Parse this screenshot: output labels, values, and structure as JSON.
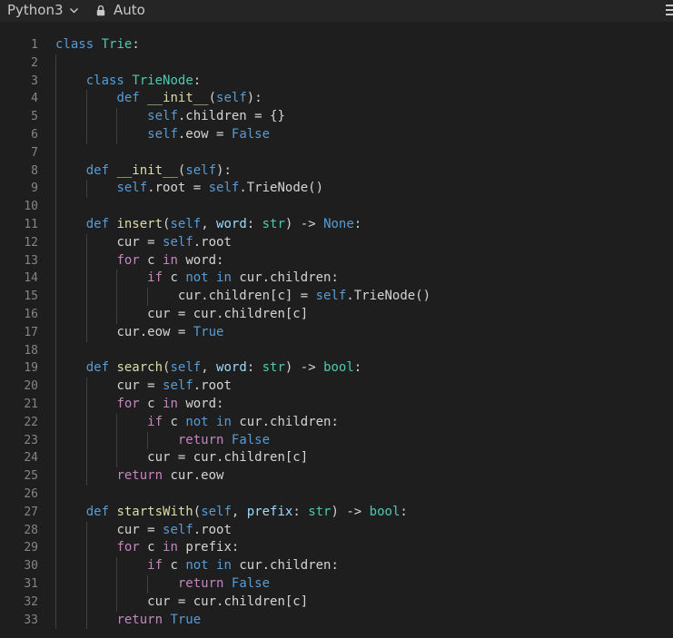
{
  "toolbar": {
    "language": "Python3",
    "language_icon": "chevron-down-icon",
    "mode": "Auto",
    "mode_icon": "lock-icon",
    "menu_icon": "hamburger-menu-icon"
  },
  "theme": {
    "background": "#1e1e1e",
    "keyword": "#569cd6",
    "control": "#c586c0",
    "class_name": "#4ec9b0",
    "function_name": "#dcdcaa",
    "parameter": "#9cdcfe",
    "text": "#d4d4d4",
    "line_number": "#858585"
  },
  "editor": {
    "lines": [
      {
        "n": "1",
        "indent": 0,
        "tokens": [
          [
            "class",
            "kw"
          ],
          [
            " ",
            ""
          ],
          [
            "Trie",
            "cls"
          ],
          [
            ":",
            ""
          ]
        ]
      },
      {
        "n": "2",
        "indent": 1,
        "tokens": []
      },
      {
        "n": "3",
        "indent": 1,
        "tokens": [
          [
            "class",
            "kw"
          ],
          [
            " ",
            ""
          ],
          [
            "TrieNode",
            "cls"
          ],
          [
            ":",
            ""
          ]
        ]
      },
      {
        "n": "4",
        "indent": 2,
        "tokens": [
          [
            "def",
            "kw"
          ],
          [
            " ",
            ""
          ],
          [
            "__init__",
            "fn"
          ],
          [
            "(",
            ""
          ],
          [
            "self",
            "slf"
          ],
          [
            "):",
            ""
          ]
        ]
      },
      {
        "n": "5",
        "indent": 3,
        "tokens": [
          [
            "self",
            "slf"
          ],
          [
            ".children = {}",
            ""
          ]
        ]
      },
      {
        "n": "6",
        "indent": 3,
        "tokens": [
          [
            "self",
            "slf"
          ],
          [
            ".eow = ",
            ""
          ],
          [
            "False",
            "kw"
          ]
        ]
      },
      {
        "n": "7",
        "indent": 1,
        "tokens": []
      },
      {
        "n": "8",
        "indent": 1,
        "tokens": [
          [
            "def",
            "kw"
          ],
          [
            " ",
            ""
          ],
          [
            "__init__",
            "fn"
          ],
          [
            "(",
            ""
          ],
          [
            "self",
            "slf"
          ],
          [
            "):",
            ""
          ]
        ]
      },
      {
        "n": "9",
        "indent": 2,
        "tokens": [
          [
            "self",
            "slf"
          ],
          [
            ".root = ",
            ""
          ],
          [
            "self",
            "slf"
          ],
          [
            ".TrieNode()",
            ""
          ]
        ]
      },
      {
        "n": "10",
        "indent": 1,
        "tokens": []
      },
      {
        "n": "11",
        "indent": 1,
        "tokens": [
          [
            "def",
            "kw"
          ],
          [
            " ",
            ""
          ],
          [
            "insert",
            "fn"
          ],
          [
            "(",
            ""
          ],
          [
            "self",
            "slf"
          ],
          [
            ", ",
            ""
          ],
          [
            "word",
            "prm"
          ],
          [
            ": ",
            ""
          ],
          [
            "str",
            "cls"
          ],
          [
            ") -> ",
            ""
          ],
          [
            "None",
            "kw"
          ],
          [
            ":",
            ""
          ]
        ]
      },
      {
        "n": "12",
        "indent": 2,
        "tokens": [
          [
            "cur = ",
            ""
          ],
          [
            "self",
            "slf"
          ],
          [
            ".root",
            ""
          ]
        ]
      },
      {
        "n": "13",
        "indent": 2,
        "tokens": [
          [
            "for",
            "ctl"
          ],
          [
            " c ",
            ""
          ],
          [
            "in",
            "ctl"
          ],
          [
            " word:",
            ""
          ]
        ]
      },
      {
        "n": "14",
        "indent": 3,
        "tokens": [
          [
            "if",
            "ctl"
          ],
          [
            " c ",
            ""
          ],
          [
            "not",
            "kw"
          ],
          [
            " ",
            ""
          ],
          [
            "in",
            "kw"
          ],
          [
            " cur.children:",
            ""
          ]
        ]
      },
      {
        "n": "15",
        "indent": 4,
        "tokens": [
          [
            "cur.children[c] = ",
            ""
          ],
          [
            "self",
            "slf"
          ],
          [
            ".TrieNode()",
            ""
          ]
        ]
      },
      {
        "n": "16",
        "indent": 3,
        "tokens": [
          [
            "cur = cur.children[c]",
            ""
          ]
        ]
      },
      {
        "n": "17",
        "indent": 2,
        "tokens": [
          [
            "cur.eow = ",
            ""
          ],
          [
            "True",
            "kw"
          ]
        ]
      },
      {
        "n": "18",
        "indent": 1,
        "tokens": []
      },
      {
        "n": "19",
        "indent": 1,
        "tokens": [
          [
            "def",
            "kw"
          ],
          [
            " ",
            ""
          ],
          [
            "search",
            "fn"
          ],
          [
            "(",
            ""
          ],
          [
            "self",
            "slf"
          ],
          [
            ", ",
            ""
          ],
          [
            "word",
            "prm"
          ],
          [
            ": ",
            ""
          ],
          [
            "str",
            "cls"
          ],
          [
            ") -> ",
            ""
          ],
          [
            "bool",
            "cls"
          ],
          [
            ":",
            ""
          ]
        ]
      },
      {
        "n": "20",
        "indent": 2,
        "tokens": [
          [
            "cur = ",
            ""
          ],
          [
            "self",
            "slf"
          ],
          [
            ".root",
            ""
          ]
        ]
      },
      {
        "n": "21",
        "indent": 2,
        "tokens": [
          [
            "for",
            "ctl"
          ],
          [
            " c ",
            ""
          ],
          [
            "in",
            "ctl"
          ],
          [
            " word:",
            ""
          ]
        ]
      },
      {
        "n": "22",
        "indent": 3,
        "tokens": [
          [
            "if",
            "ctl"
          ],
          [
            " c ",
            ""
          ],
          [
            "not",
            "kw"
          ],
          [
            " ",
            ""
          ],
          [
            "in",
            "kw"
          ],
          [
            " cur.children:",
            ""
          ]
        ]
      },
      {
        "n": "23",
        "indent": 4,
        "tokens": [
          [
            "return",
            "ctl"
          ],
          [
            " ",
            ""
          ],
          [
            "False",
            "kw"
          ]
        ]
      },
      {
        "n": "24",
        "indent": 3,
        "tokens": [
          [
            "cur = cur.children[c]",
            ""
          ]
        ]
      },
      {
        "n": "25",
        "indent": 2,
        "tokens": [
          [
            "return",
            "ctl"
          ],
          [
            " cur.eow",
            ""
          ]
        ]
      },
      {
        "n": "26",
        "indent": 1,
        "tokens": []
      },
      {
        "n": "27",
        "indent": 1,
        "tokens": [
          [
            "def",
            "kw"
          ],
          [
            " ",
            ""
          ],
          [
            "startsWith",
            "fn"
          ],
          [
            "(",
            ""
          ],
          [
            "self",
            "slf"
          ],
          [
            ", ",
            ""
          ],
          [
            "prefix",
            "prm"
          ],
          [
            ": ",
            ""
          ],
          [
            "str",
            "cls"
          ],
          [
            ") -> ",
            ""
          ],
          [
            "bool",
            "cls"
          ],
          [
            ":",
            ""
          ]
        ]
      },
      {
        "n": "28",
        "indent": 2,
        "tokens": [
          [
            "cur = ",
            ""
          ],
          [
            "self",
            "slf"
          ],
          [
            ".root",
            ""
          ]
        ]
      },
      {
        "n": "29",
        "indent": 2,
        "tokens": [
          [
            "for",
            "ctl"
          ],
          [
            " c ",
            ""
          ],
          [
            "in",
            "ctl"
          ],
          [
            " prefix:",
            ""
          ]
        ]
      },
      {
        "n": "30",
        "indent": 3,
        "tokens": [
          [
            "if",
            "ctl"
          ],
          [
            " c ",
            ""
          ],
          [
            "not",
            "kw"
          ],
          [
            " ",
            ""
          ],
          [
            "in",
            "kw"
          ],
          [
            " cur.children:",
            ""
          ]
        ]
      },
      {
        "n": "31",
        "indent": 4,
        "tokens": [
          [
            "return",
            "ctl"
          ],
          [
            " ",
            ""
          ],
          [
            "False",
            "kw"
          ]
        ]
      },
      {
        "n": "32",
        "indent": 3,
        "tokens": [
          [
            "cur = cur.children[c]",
            ""
          ]
        ]
      },
      {
        "n": "33",
        "indent": 2,
        "tokens": [
          [
            "return",
            "ctl"
          ],
          [
            " ",
            ""
          ],
          [
            "True",
            "kw"
          ]
        ]
      }
    ]
  }
}
